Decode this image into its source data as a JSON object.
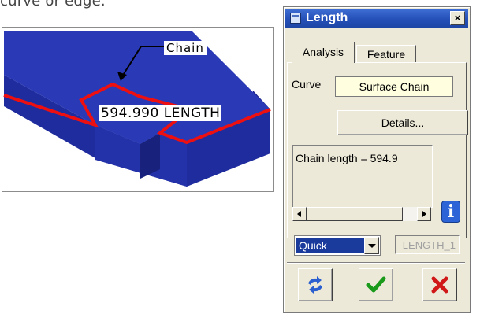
{
  "caption_fragment": "curve or edge.",
  "figure": {
    "chain_label": "Chain",
    "length_label": "594.990 LENGTH"
  },
  "dialog": {
    "title": "Length",
    "close_glyph": "×",
    "tabs": [
      {
        "label": "Analysis",
        "active": true
      },
      {
        "label": "Feature",
        "active": false
      }
    ],
    "curve_label": "Curve",
    "curve_value": "Surface Chain",
    "details_button": "Details...",
    "result_text": "Chain length = 594.9",
    "info_glyph": "i",
    "mode_select": {
      "value": "Quick"
    },
    "name_field": "LENGTH_1",
    "actions": [
      {
        "name": "swap",
        "icon": "repeat-arrows-icon"
      },
      {
        "name": "ok",
        "icon": "check-icon"
      },
      {
        "name": "cancel",
        "icon": "x-icon"
      }
    ]
  },
  "colors": {
    "model_blue": "#2a39b6",
    "chain_red": "#ee1010",
    "titlebar_blue": "#2550b8",
    "dialog_bg": "#ece9d8"
  }
}
